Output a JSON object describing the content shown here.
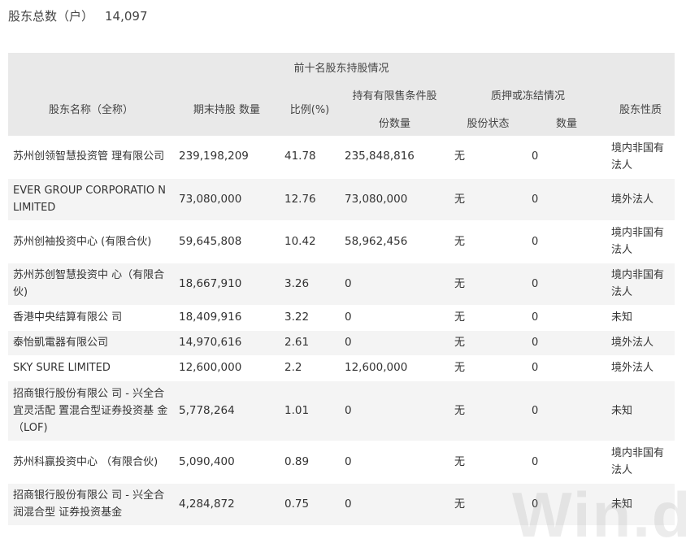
{
  "summary": {
    "label": "股东总数（户）",
    "value": "14,097"
  },
  "table": {
    "group_title": "前十名股东持股情况",
    "headers": {
      "name": "股东名称（全称）",
      "shares": "期末持股 数量",
      "ratio": "比例(%)",
      "restricted_line1": "持有有限售条件股",
      "restricted_line2": "份数量",
      "pledge": "质押或冻结情况",
      "pledge_status": "股份状态",
      "pledge_qty": "数量",
      "nature": "股东性质"
    },
    "rows": [
      {
        "name": "苏州创领智慧投资管 理有限公司",
        "shares": "239,198,209",
        "ratio": "41.78",
        "restricted": "235,848,816",
        "status": "无",
        "qty": "0",
        "nature": "境内非国有法人"
      },
      {
        "name": "EVER GROUP CORPORATIO N LIMITED",
        "shares": "73,080,000",
        "ratio": "12.76",
        "restricted": "73,080,000",
        "status": "无",
        "qty": "0",
        "nature": "境外法人"
      },
      {
        "name": "苏州创袖投资中心 (有限合伙)",
        "shares": "59,645,808",
        "ratio": "10.42",
        "restricted": "58,962,456",
        "status": "无",
        "qty": "0",
        "nature": "境内非国有法人"
      },
      {
        "name": "苏州苏创智慧投资中 心（有限合伙)",
        "shares": "18,667,910",
        "ratio": "3.26",
        "restricted": "0",
        "status": "无",
        "qty": "0",
        "nature": "境内非国有法人"
      },
      {
        "name": "香港中央结算有限公 司",
        "shares": "18,409,916",
        "ratio": "3.22",
        "restricted": "0",
        "status": "无",
        "qty": "0",
        "nature": "未知"
      },
      {
        "name": "泰怡凱電器有限公司",
        "shares": "14,970,616",
        "ratio": "2.61",
        "restricted": "0",
        "status": "无",
        "qty": "0",
        "nature": "境外法人"
      },
      {
        "name": "SKY SURE LIMITED",
        "shares": "12,600,000",
        "ratio": "2.2",
        "restricted": "12,600,000",
        "status": "无",
        "qty": "0",
        "nature": "境外法人"
      },
      {
        "name": "招商银行股份有限公 司 - 兴全合宜灵活配 置混合型证券投资基 金（LOF)",
        "shares": "5,778,264",
        "ratio": "1.01",
        "restricted": "0",
        "status": "无",
        "qty": "0",
        "nature": "未知"
      },
      {
        "name": "苏州科赢投资中心 （有限合伙)",
        "shares": "5,090,400",
        "ratio": "0.89",
        "restricted": "0",
        "status": "无",
        "qty": "0",
        "nature": "境内非国有法人"
      },
      {
        "name": "招商银行股份有限公 司 - 兴全合润混合型 证券投资基金",
        "shares": "4,284,872",
        "ratio": "0.75",
        "restricted": "0",
        "status": "无",
        "qty": "0",
        "nature": "未知"
      }
    ]
  },
  "watermark": "Win.d"
}
